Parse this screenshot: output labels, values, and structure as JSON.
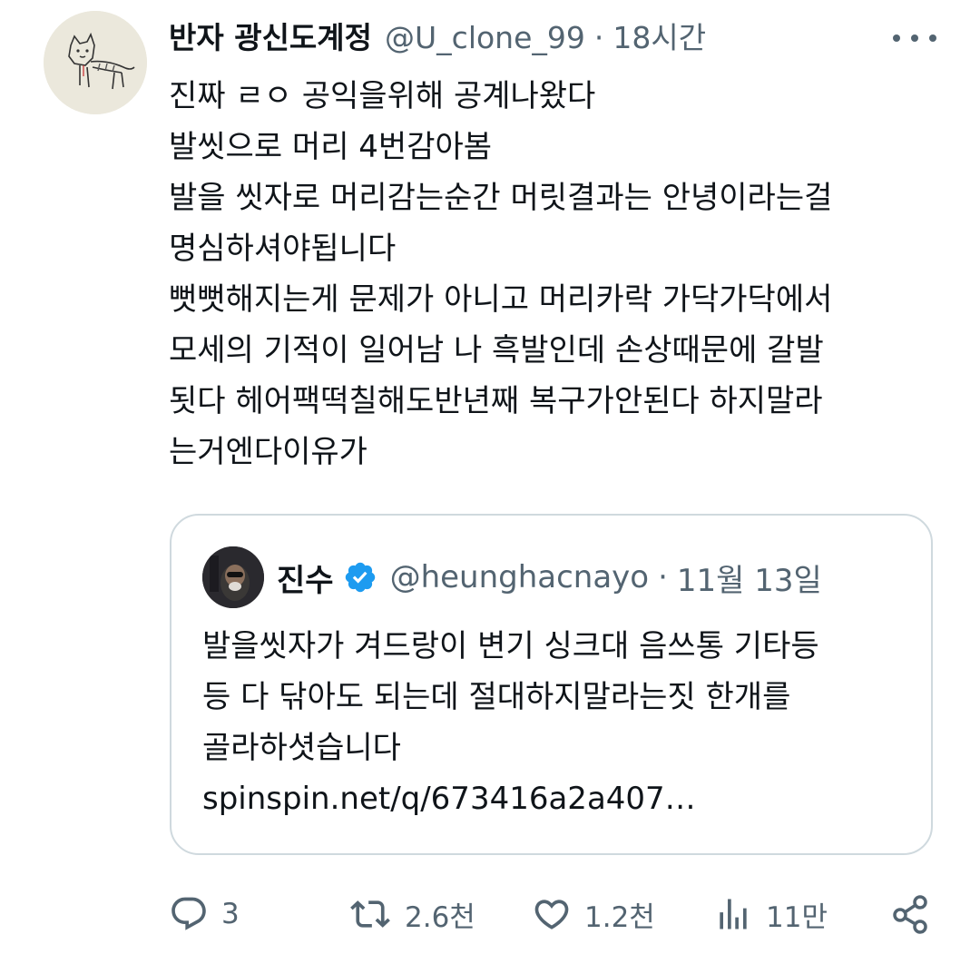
{
  "tweet": {
    "display_name": "반자 광신도계정",
    "handle": "@U_clone_99",
    "separator": "·",
    "time": "18시간",
    "lines": [
      "진짜 ㄹㅇ 공익을위해 공계나왔다",
      "발씻으로 머리 4번감아봄",
      "발을 씻자로 머리감는순간 머릿결과는 안녕이라는걸",
      "명심하셔야됩니다",
      "뻣뻣해지는게 문제가 아니고 머리카락 가닥가닥에서",
      "모세의 기적이 일어남 나 흑발인데 손상때문에 갈발",
      "됫다 헤어팩떡칠해도반년째 복구가안된다 하지말라",
      "는거엔다이유가"
    ]
  },
  "quote": {
    "display_name": "진수",
    "handle": "@heunghacnayo",
    "separator": "·",
    "time": "11월 13일",
    "lines": [
      "발을씻자가 겨드랑이 변기 싱크대 음쓰통 기타등",
      "등 다 닦아도 되는데 절대하지말라는짓 한개를",
      "골라하셧습니다",
      "spinspin.net/q/673416a2a407…"
    ]
  },
  "actions": {
    "reply_count": "3",
    "retweet_count": "2.6천",
    "like_count": "1.2천",
    "view_count": "11만"
  },
  "icons": {
    "reply": "reply-icon",
    "retweet": "retweet-icon",
    "like": "heart-icon",
    "views": "views-icon",
    "share": "share-icon",
    "more": "more-icon",
    "verified": "verified-badge-icon"
  },
  "colors": {
    "text": "#0f1419",
    "secondary": "#536471",
    "border": "#cfd9de",
    "verified": "#1d9bf0"
  }
}
